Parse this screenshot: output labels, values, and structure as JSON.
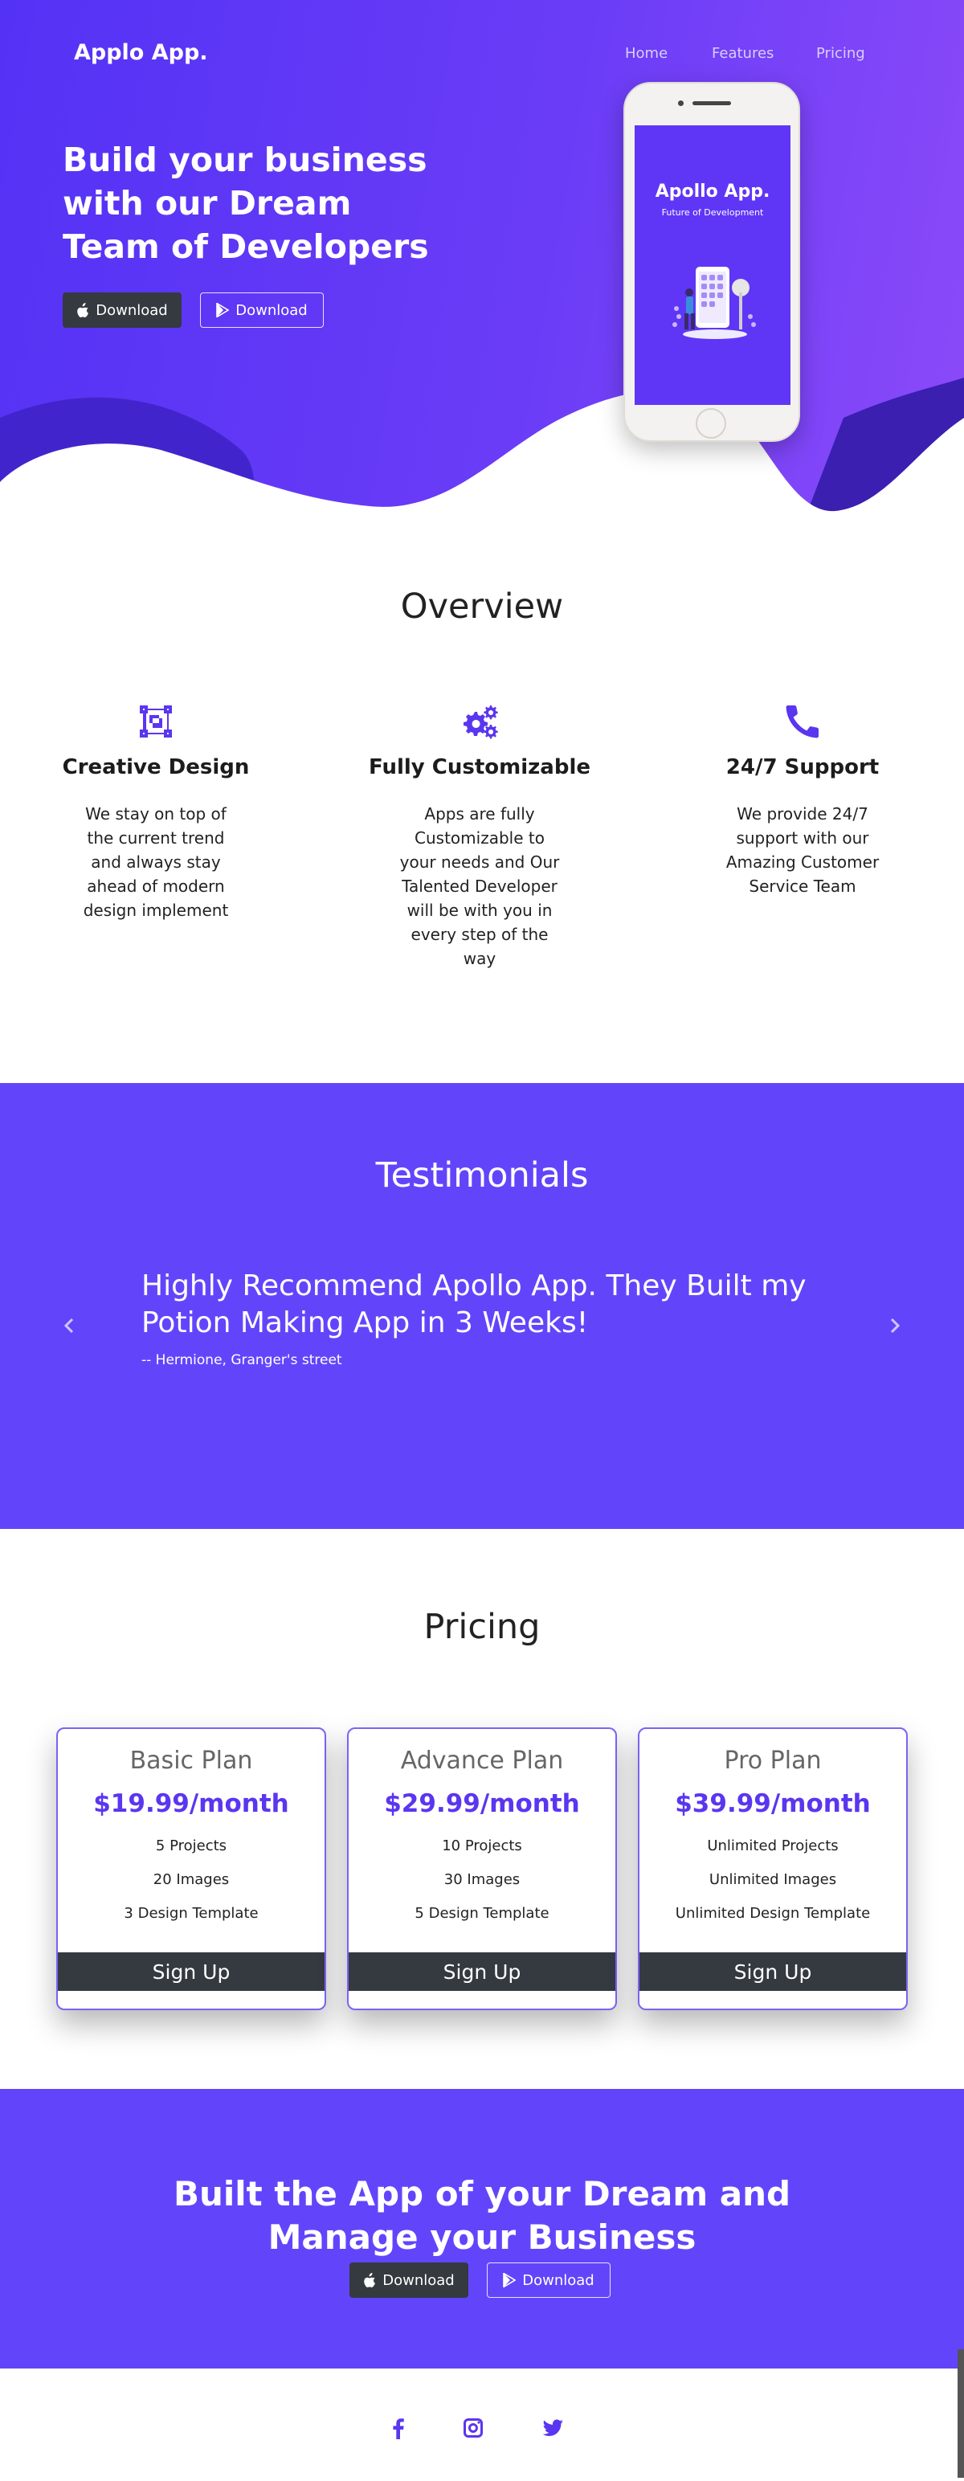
{
  "header": {
    "brand": "Applo App.",
    "nav": [
      "Home",
      "Features",
      "Pricing"
    ]
  },
  "hero": {
    "title_lines": [
      "Build your business",
      "with our Dream",
      "Team of Developers"
    ],
    "download_apple": "Download",
    "download_play": "Download"
  },
  "phone": {
    "title": "Apollo App.",
    "subtitle": "Future of Development"
  },
  "overview": {
    "title": "Overview",
    "features": [
      {
        "icon": "design-icon",
        "title": "Creative Design",
        "text": "We stay on top of the current trend and always stay ahead of modern design implement"
      },
      {
        "icon": "cogs-icon",
        "title": "Fully Customizable",
        "text": "Apps are fully Customizable to your needs and Our Talented Developer will be with you in every step of the way"
      },
      {
        "icon": "phone-icon",
        "title": "24/7 Support",
        "text": "We provide 24/7 support with our Amazing Customer Service Team"
      }
    ]
  },
  "testimonials": {
    "title": "Testimonials",
    "quote": "Highly Recommend Apollo App. They Built my Potion Making App in 3 Weeks!",
    "author": "-- Hermione, Granger's street"
  },
  "pricing": {
    "title": "Pricing",
    "plans": [
      {
        "name": "Basic Plan",
        "price": "$19.99/month",
        "features": [
          "5 Projects",
          "20 Images",
          "3 Design Template"
        ],
        "button": "Sign Up"
      },
      {
        "name": "Advance Plan",
        "price": "$29.99/month",
        "features": [
          "10 Projects",
          "30 Images",
          "5 Design Template"
        ],
        "button": "Sign Up"
      },
      {
        "name": "Pro Plan",
        "price": "$39.99/month",
        "features": [
          "Unlimited Projects",
          "Unlimited Images",
          "Unlimited Design Template"
        ],
        "button": "Sign Up"
      }
    ]
  },
  "cta": {
    "title_lines": [
      "Built the App of your Dream and",
      "Manage your Business"
    ],
    "download_apple": "Download",
    "download_play": "Download"
  },
  "footer": {
    "social": [
      "facebook-icon",
      "instagram-icon",
      "twitter-icon"
    ]
  },
  "colors": {
    "accent": "#5a36f0",
    "section_bg": "#6245fb",
    "button_dark": "#343a40"
  }
}
